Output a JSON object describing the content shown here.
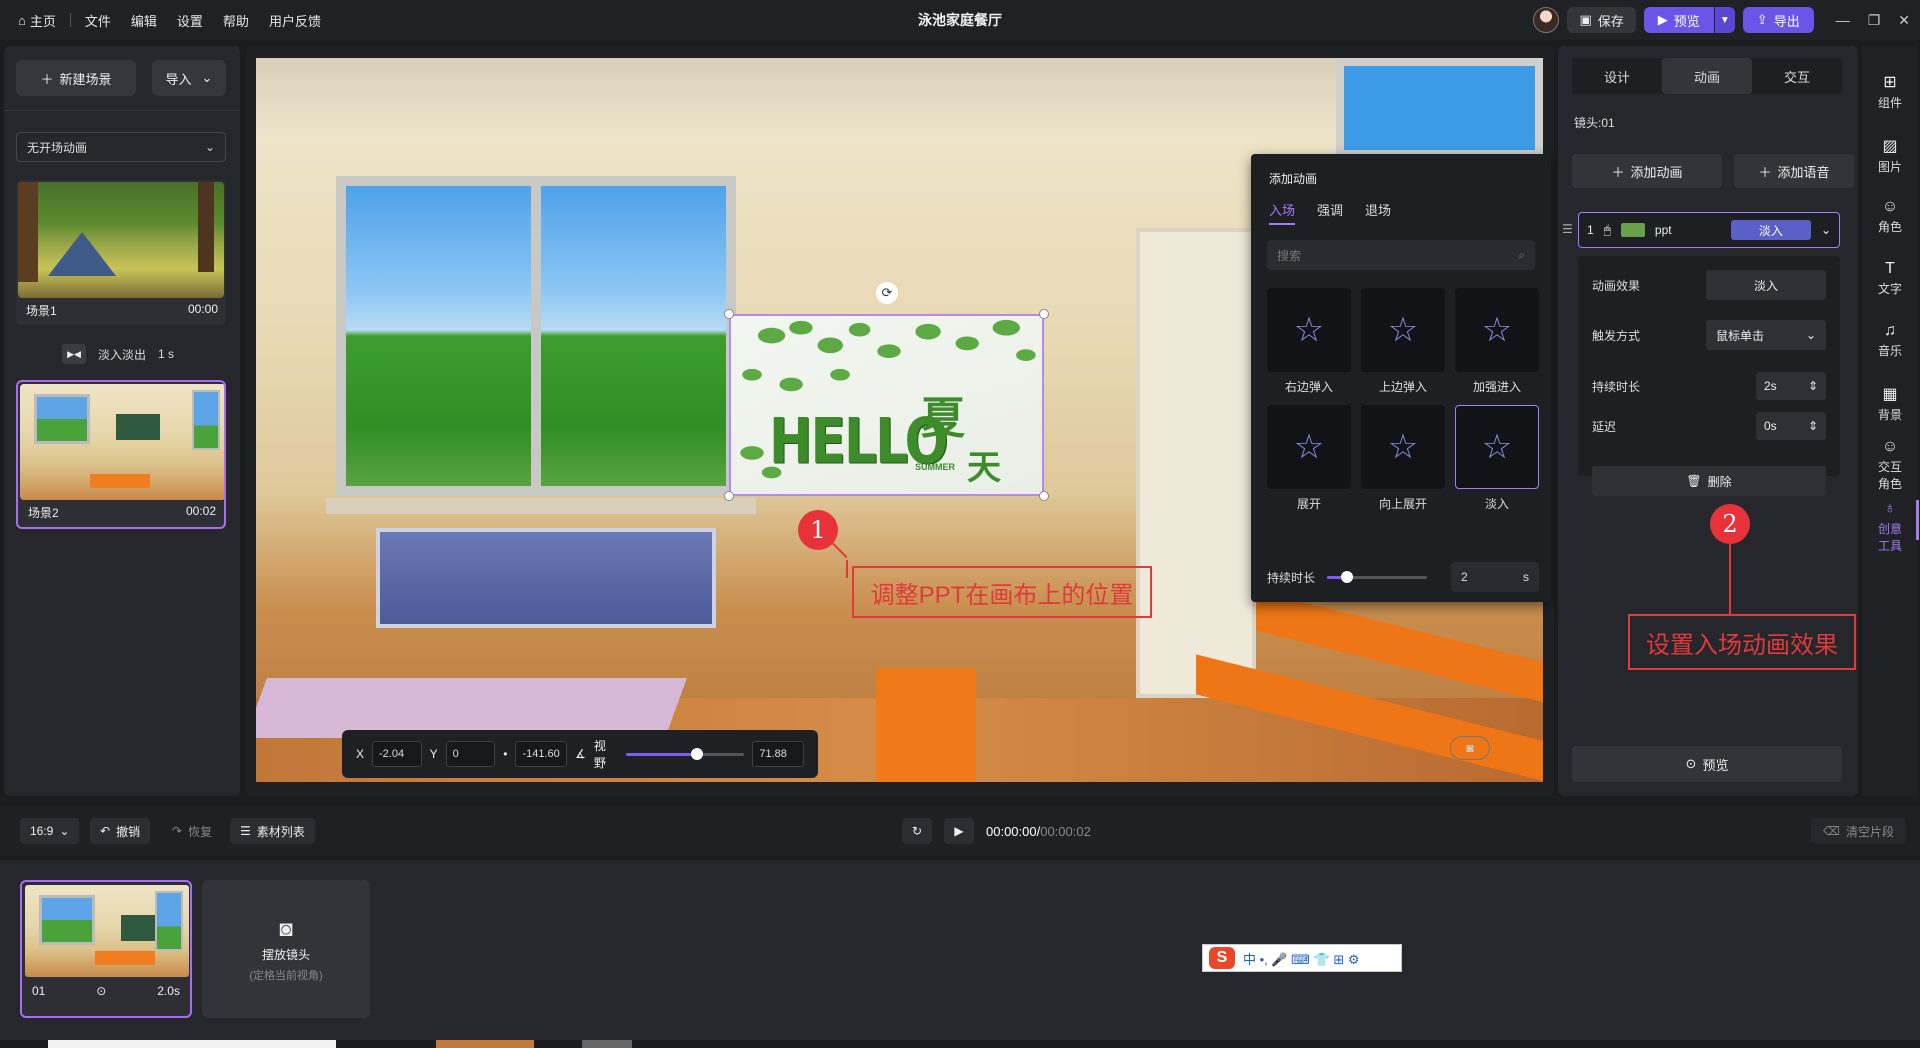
{
  "menu": {
    "home": "主页",
    "items": [
      "文件",
      "编辑",
      "设置",
      "帮助",
      "用户反馈"
    ]
  },
  "app_title": "泳池家庭餐厅",
  "top_actions": {
    "save": "保存",
    "preview": "预览",
    "export": "导出"
  },
  "left": {
    "new_scene": "新建场景",
    "import": "导入",
    "opening_anim": "无开场动画",
    "scenes": [
      {
        "name": "场景1",
        "time": "00:00"
      },
      {
        "name": "场景2",
        "time": "00:02"
      }
    ],
    "transition": {
      "label": "淡入淡出",
      "duration": "1 s"
    }
  },
  "canvas": {
    "ppt": {
      "hello": "HELLO",
      "xia": "夏",
      "tian": "天",
      "summer": "SUMMER"
    },
    "callout1": {
      "num": "1",
      "text": "调整PPT在画布上的位置"
    },
    "callout2": {
      "num": "2",
      "text": "设置入场动画效果"
    },
    "transform": {
      "x_label": "X",
      "x": "-2.04",
      "y_label": "Y",
      "y": "0",
      "rot_label": "•",
      "rot": "-141.60",
      "fov_label": "视野",
      "fov": "71.88",
      "fov_level": 0.6
    }
  },
  "anim_popup": {
    "title": "添加动画",
    "tabs": [
      "入场",
      "强调",
      "退场"
    ],
    "search_placeholder": "搜索",
    "effects": [
      "右边弹入",
      "上边弹入",
      "加强进入",
      "展开",
      "向上展开",
      "淡入"
    ],
    "duration_label": "持续时长",
    "duration_value": "2",
    "duration_unit": "s",
    "duration_level": 0.2
  },
  "right": {
    "tabs": [
      "设计",
      "动画",
      "交互"
    ],
    "lens": "镜头:01",
    "add_anim": "添加动画",
    "add_voice": "添加语音",
    "item": {
      "index": "1",
      "name": "ppt",
      "effect": "淡入"
    },
    "props": {
      "effect_label": "动画效果",
      "effect_value": "淡入",
      "trigger_label": "触发方式",
      "trigger_value": "鼠标单击",
      "duration_label": "持续时长",
      "duration_value": "2s",
      "delay_label": "延迟",
      "delay_value": "0s",
      "delete": "删除"
    },
    "preview": "预览"
  },
  "side_toolbar": [
    "组件",
    "图片",
    "角色",
    "文字",
    "音乐",
    "背景",
    "交互角色",
    "创意工具"
  ],
  "bottom": {
    "ratio": "16:9",
    "undo": "撤销",
    "redo": "恢复",
    "assets": "素材列表",
    "time_current": "00:00:00/",
    "time_total": "00:00:02",
    "clear": "清空片段"
  },
  "timeline": {
    "clip": {
      "index": "01",
      "duration": "2.0s"
    },
    "camera": {
      "label": "摆放镜头",
      "sub": "(定格当前视角)"
    }
  },
  "ime": {
    "logo": "S",
    "chars": "中 •, 🎤 ⌨ 👕 ⊞ ⚙"
  },
  "colors": {
    "accent": "#a37cf7",
    "primary": "#6b54e8",
    "callout": "#e03a3a"
  }
}
